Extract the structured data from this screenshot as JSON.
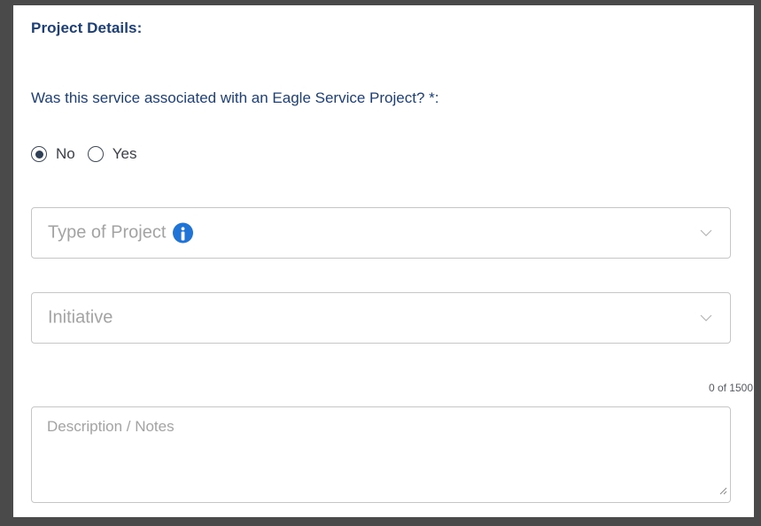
{
  "section": {
    "title": "Project Details:",
    "question": "Was this service associated with an Eagle Service Project? *:"
  },
  "radio_options": [
    {
      "label": "No",
      "selected": true
    },
    {
      "label": "Yes",
      "selected": false
    }
  ],
  "fields": {
    "type_of_project": {
      "placeholder": "Type of Project",
      "icon": "info-icon",
      "dropdown_icon": "chevron-down-icon"
    },
    "initiative": {
      "placeholder": "Initiative",
      "dropdown_icon": "chevron-down-icon"
    },
    "description": {
      "placeholder": "Description / Notes",
      "counter": "0 of 1500",
      "resize_icon": "resize-handle-icon"
    }
  },
  "colors": {
    "heading": "#1c3f78",
    "info_icon": "#1f74d6",
    "border": "#c6c6c6",
    "placeholder": "#a3a3a3",
    "frame": "#4a4a4a"
  }
}
